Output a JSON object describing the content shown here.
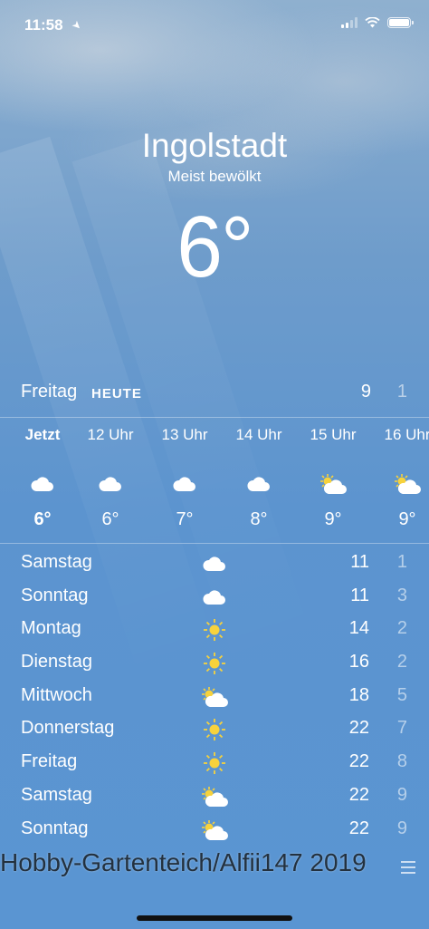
{
  "status_bar": {
    "time": "11:58"
  },
  "header": {
    "city": "Ingolstadt",
    "condition": "Meist bewölkt",
    "temperature": "6°"
  },
  "today": {
    "day": "Freitag",
    "label": "HEUTE",
    "high": "9",
    "low": "1"
  },
  "hourly": [
    {
      "time": "Jetzt",
      "icon": "cloud-icon",
      "temp": "6°"
    },
    {
      "time": "12 Uhr",
      "icon": "cloud-icon",
      "temp": "6°"
    },
    {
      "time": "13 Uhr",
      "icon": "cloud-icon",
      "temp": "7°"
    },
    {
      "time": "14 Uhr",
      "icon": "cloud-icon",
      "temp": "8°"
    },
    {
      "time": "15 Uhr",
      "icon": "partly-sunny-icon",
      "temp": "9°"
    },
    {
      "time": "16 Uhr",
      "icon": "partly-sunny-icon",
      "temp": "9°"
    }
  ],
  "daily": [
    {
      "day": "Samstag",
      "icon": "cloud-icon",
      "high": "11",
      "low": "1"
    },
    {
      "day": "Sonntag",
      "icon": "cloud-icon",
      "high": "11",
      "low": "3"
    },
    {
      "day": "Montag",
      "icon": "sun-icon",
      "high": "14",
      "low": "2"
    },
    {
      "day": "Dienstag",
      "icon": "sun-icon",
      "high": "16",
      "low": "2"
    },
    {
      "day": "Mittwoch",
      "icon": "partly-sunny-icon",
      "high": "18",
      "low": "5"
    },
    {
      "day": "Donnerstag",
      "icon": "sun-icon",
      "high": "22",
      "low": "7"
    },
    {
      "day": "Freitag",
      "icon": "sun-icon",
      "high": "22",
      "low": "8"
    },
    {
      "day": "Samstag",
      "icon": "partly-sunny-icon",
      "high": "22",
      "low": "9"
    },
    {
      "day": "Sonntag",
      "icon": "partly-sunny-icon",
      "high": "22",
      "low": "9"
    }
  ],
  "watermark": "Hobby-Gartenteich/Alfii147 2019",
  "colors": {
    "sun": "#f7d23c",
    "cloud": "#ffffff",
    "watermark": "#23313f"
  }
}
